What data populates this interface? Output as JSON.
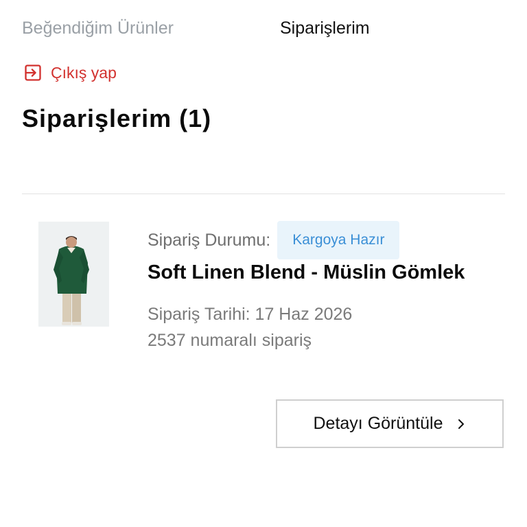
{
  "account_menu": {
    "favorites_label": "Beğendiğim Ürünler",
    "orders_label": "Siparişlerim"
  },
  "logout": {
    "label": "Çıkış yap",
    "icon": "logout-icon",
    "color": "#d2312e"
  },
  "orders": {
    "title": "Siparişlerim (1)",
    "items": [
      {
        "status_label": "Sipariş Durumu:",
        "status_value": "Kargoya Hazır",
        "status_color": "#3a8fd6",
        "product_name": "Soft Linen Blend - Müslin Gömlek",
        "date_text": "Sipariş Tarihi: 17 Haz 2026",
        "order_number_text": "2537 numaralı sipariş",
        "detail_button_label": "Detayı Görüntüle",
        "detail_button_icon": "chevron-right-icon"
      }
    ]
  }
}
